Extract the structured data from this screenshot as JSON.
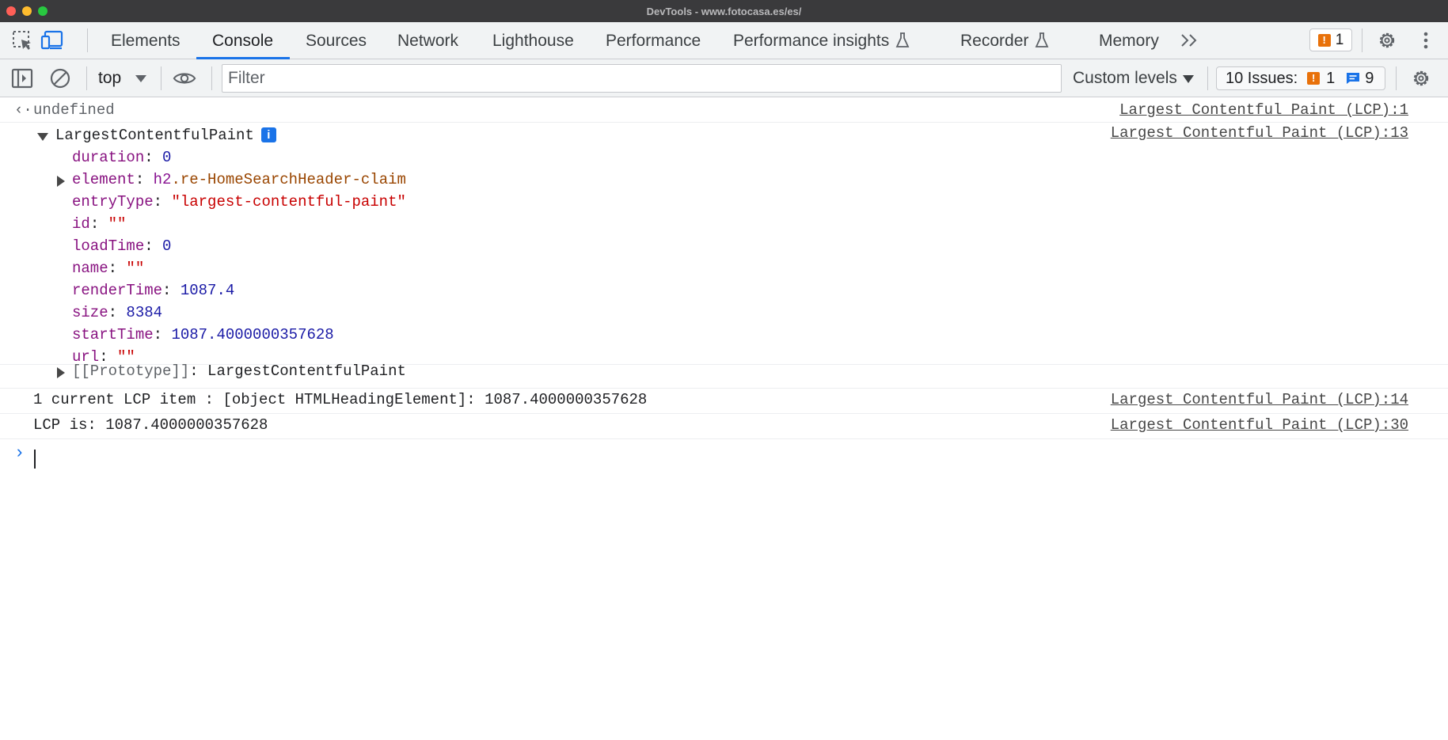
{
  "window": {
    "title": "DevTools - www.fotocasa.es/es/"
  },
  "toolbar": {
    "tabs": [
      {
        "label": "Elements"
      },
      {
        "label": "Console"
      },
      {
        "label": "Sources"
      },
      {
        "label": "Network"
      },
      {
        "label": "Lighthouse"
      },
      {
        "label": "Performance"
      },
      {
        "label": "Performance insights"
      },
      {
        "label": "Recorder"
      },
      {
        "label": "Memory"
      }
    ],
    "active_tab": "Console",
    "warning_count": "1",
    "icons": [
      "inspect-element-icon",
      "device-toolbar-icon",
      "more-tabs-icon",
      "settings-icon",
      "kebab-menu-icon"
    ]
  },
  "console_toolbar": {
    "context": "top",
    "filter_placeholder": "Filter",
    "levels_label": "Custom levels",
    "issues_label": "10 Issues:",
    "issues_warnings": "1",
    "issues_messages": "9",
    "icons": [
      "sidebar-toggle-icon",
      "clear-console-icon",
      "live-expression-eye-icon",
      "console-settings-icon"
    ]
  },
  "console": {
    "entries": [
      {
        "prefix": "‹·",
        "text": "undefined",
        "source": "Largest Contentful Paint (LCP):1"
      },
      {
        "object_name": "LargestContentfulPaint",
        "info_badge": "i",
        "source": "Largest Contentful Paint (LCP):13",
        "properties": [
          {
            "key": "duration",
            "value": "0",
            "kind": "num"
          },
          {
            "key": "element",
            "value_tag": "h2",
            "value_class": ".re-HomeSearchHeader-claim",
            "kind": "element",
            "expandable": true
          },
          {
            "key": "entryType",
            "value": "\"largest-contentful-paint\"",
            "kind": "str"
          },
          {
            "key": "id",
            "value": "\"\"",
            "kind": "str"
          },
          {
            "key": "loadTime",
            "value": "0",
            "kind": "num"
          },
          {
            "key": "name",
            "value": "\"\"",
            "kind": "str"
          },
          {
            "key": "renderTime",
            "value": "1087.4",
            "kind": "num"
          },
          {
            "key": "size",
            "value": "8384",
            "kind": "num"
          },
          {
            "key": "startTime",
            "value": "1087.4000000357628",
            "kind": "num"
          },
          {
            "key": "url",
            "value": "\"\"",
            "kind": "str"
          }
        ],
        "prototype_key": "[[Prototype]]",
        "prototype_value": "LargestContentfulPaint"
      },
      {
        "text": "1 current LCP item : [object HTMLHeadingElement]: 1087.4000000357628",
        "source": "Largest Contentful Paint (LCP):14"
      },
      {
        "text": "LCP is: 1087.4000000357628",
        "source": "Largest Contentful Paint (LCP):30"
      }
    ],
    "prompt_symbol": "›"
  }
}
